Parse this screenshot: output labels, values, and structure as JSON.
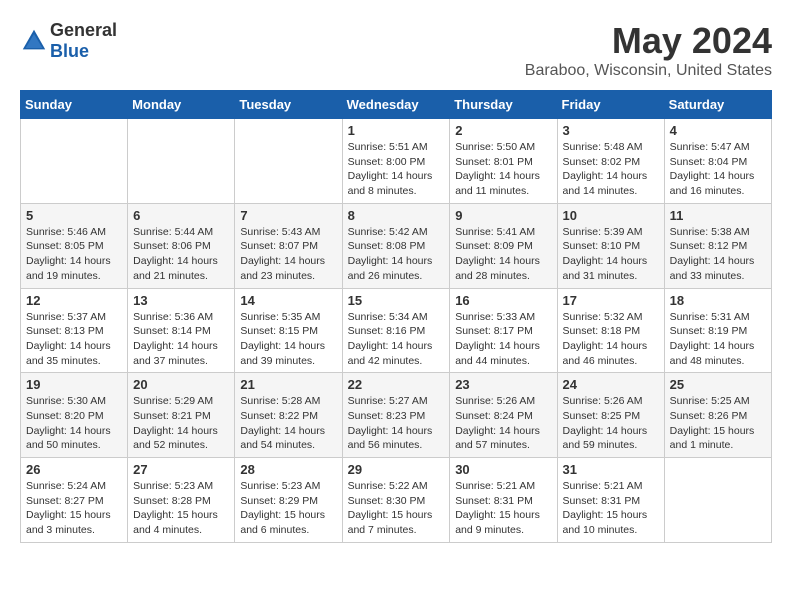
{
  "logo": {
    "general": "General",
    "blue": "Blue"
  },
  "title": {
    "month_year": "May 2024",
    "location": "Baraboo, Wisconsin, United States"
  },
  "weekdays": [
    "Sunday",
    "Monday",
    "Tuesday",
    "Wednesday",
    "Thursday",
    "Friday",
    "Saturday"
  ],
  "weeks": [
    [
      {
        "day": "",
        "info": ""
      },
      {
        "day": "",
        "info": ""
      },
      {
        "day": "",
        "info": ""
      },
      {
        "day": "1",
        "info": "Sunrise: 5:51 AM\nSunset: 8:00 PM\nDaylight: 14 hours\nand 8 minutes."
      },
      {
        "day": "2",
        "info": "Sunrise: 5:50 AM\nSunset: 8:01 PM\nDaylight: 14 hours\nand 11 minutes."
      },
      {
        "day": "3",
        "info": "Sunrise: 5:48 AM\nSunset: 8:02 PM\nDaylight: 14 hours\nand 14 minutes."
      },
      {
        "day": "4",
        "info": "Sunrise: 5:47 AM\nSunset: 8:04 PM\nDaylight: 14 hours\nand 16 minutes."
      }
    ],
    [
      {
        "day": "5",
        "info": "Sunrise: 5:46 AM\nSunset: 8:05 PM\nDaylight: 14 hours\nand 19 minutes."
      },
      {
        "day": "6",
        "info": "Sunrise: 5:44 AM\nSunset: 8:06 PM\nDaylight: 14 hours\nand 21 minutes."
      },
      {
        "day": "7",
        "info": "Sunrise: 5:43 AM\nSunset: 8:07 PM\nDaylight: 14 hours\nand 23 minutes."
      },
      {
        "day": "8",
        "info": "Sunrise: 5:42 AM\nSunset: 8:08 PM\nDaylight: 14 hours\nand 26 minutes."
      },
      {
        "day": "9",
        "info": "Sunrise: 5:41 AM\nSunset: 8:09 PM\nDaylight: 14 hours\nand 28 minutes."
      },
      {
        "day": "10",
        "info": "Sunrise: 5:39 AM\nSunset: 8:10 PM\nDaylight: 14 hours\nand 31 minutes."
      },
      {
        "day": "11",
        "info": "Sunrise: 5:38 AM\nSunset: 8:12 PM\nDaylight: 14 hours\nand 33 minutes."
      }
    ],
    [
      {
        "day": "12",
        "info": "Sunrise: 5:37 AM\nSunset: 8:13 PM\nDaylight: 14 hours\nand 35 minutes."
      },
      {
        "day": "13",
        "info": "Sunrise: 5:36 AM\nSunset: 8:14 PM\nDaylight: 14 hours\nand 37 minutes."
      },
      {
        "day": "14",
        "info": "Sunrise: 5:35 AM\nSunset: 8:15 PM\nDaylight: 14 hours\nand 39 minutes."
      },
      {
        "day": "15",
        "info": "Sunrise: 5:34 AM\nSunset: 8:16 PM\nDaylight: 14 hours\nand 42 minutes."
      },
      {
        "day": "16",
        "info": "Sunrise: 5:33 AM\nSunset: 8:17 PM\nDaylight: 14 hours\nand 44 minutes."
      },
      {
        "day": "17",
        "info": "Sunrise: 5:32 AM\nSunset: 8:18 PM\nDaylight: 14 hours\nand 46 minutes."
      },
      {
        "day": "18",
        "info": "Sunrise: 5:31 AM\nSunset: 8:19 PM\nDaylight: 14 hours\nand 48 minutes."
      }
    ],
    [
      {
        "day": "19",
        "info": "Sunrise: 5:30 AM\nSunset: 8:20 PM\nDaylight: 14 hours\nand 50 minutes."
      },
      {
        "day": "20",
        "info": "Sunrise: 5:29 AM\nSunset: 8:21 PM\nDaylight: 14 hours\nand 52 minutes."
      },
      {
        "day": "21",
        "info": "Sunrise: 5:28 AM\nSunset: 8:22 PM\nDaylight: 14 hours\nand 54 minutes."
      },
      {
        "day": "22",
        "info": "Sunrise: 5:27 AM\nSunset: 8:23 PM\nDaylight: 14 hours\nand 56 minutes."
      },
      {
        "day": "23",
        "info": "Sunrise: 5:26 AM\nSunset: 8:24 PM\nDaylight: 14 hours\nand 57 minutes."
      },
      {
        "day": "24",
        "info": "Sunrise: 5:26 AM\nSunset: 8:25 PM\nDaylight: 14 hours\nand 59 minutes."
      },
      {
        "day": "25",
        "info": "Sunrise: 5:25 AM\nSunset: 8:26 PM\nDaylight: 15 hours\nand 1 minute."
      }
    ],
    [
      {
        "day": "26",
        "info": "Sunrise: 5:24 AM\nSunset: 8:27 PM\nDaylight: 15 hours\nand 3 minutes."
      },
      {
        "day": "27",
        "info": "Sunrise: 5:23 AM\nSunset: 8:28 PM\nDaylight: 15 hours\nand 4 minutes."
      },
      {
        "day": "28",
        "info": "Sunrise: 5:23 AM\nSunset: 8:29 PM\nDaylight: 15 hours\nand 6 minutes."
      },
      {
        "day": "29",
        "info": "Sunrise: 5:22 AM\nSunset: 8:30 PM\nDaylight: 15 hours\nand 7 minutes."
      },
      {
        "day": "30",
        "info": "Sunrise: 5:21 AM\nSunset: 8:31 PM\nDaylight: 15 hours\nand 9 minutes."
      },
      {
        "day": "31",
        "info": "Sunrise: 5:21 AM\nSunset: 8:31 PM\nDaylight: 15 hours\nand 10 minutes."
      },
      {
        "day": "",
        "info": ""
      }
    ]
  ]
}
